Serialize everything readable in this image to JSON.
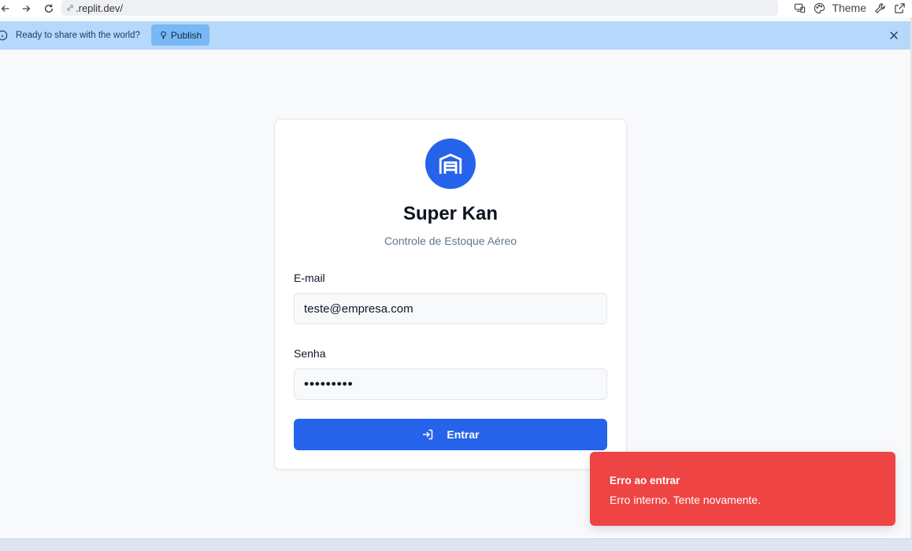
{
  "browser": {
    "url": ".replit.dev/",
    "theme_label": "Theme"
  },
  "banner": {
    "message": "Ready to share with the world?",
    "publish_label": "Publish"
  },
  "login": {
    "app_title": "Super Kan",
    "app_subtitle": "Controle de Estoque Aéreo",
    "email_label": "E-mail",
    "email_value": "teste@empresa.com",
    "password_label": "Senha",
    "password_value": "•••••••••",
    "submit_label": "Entrar"
  },
  "toast": {
    "title": "Erro ao entrar",
    "description": "Erro interno. Tente novamente.",
    "color": "#ef4444"
  },
  "colors": {
    "primary": "#2563eb",
    "banner": "#b5d8fb"
  },
  "icons": [
    "back-icon",
    "forward-icon",
    "reload-icon",
    "link-icon",
    "devices-icon",
    "palette-icon",
    "wrench-icon",
    "external-link-icon",
    "info-icon",
    "publish-icon",
    "close-icon",
    "warehouse-icon",
    "login-icon"
  ]
}
